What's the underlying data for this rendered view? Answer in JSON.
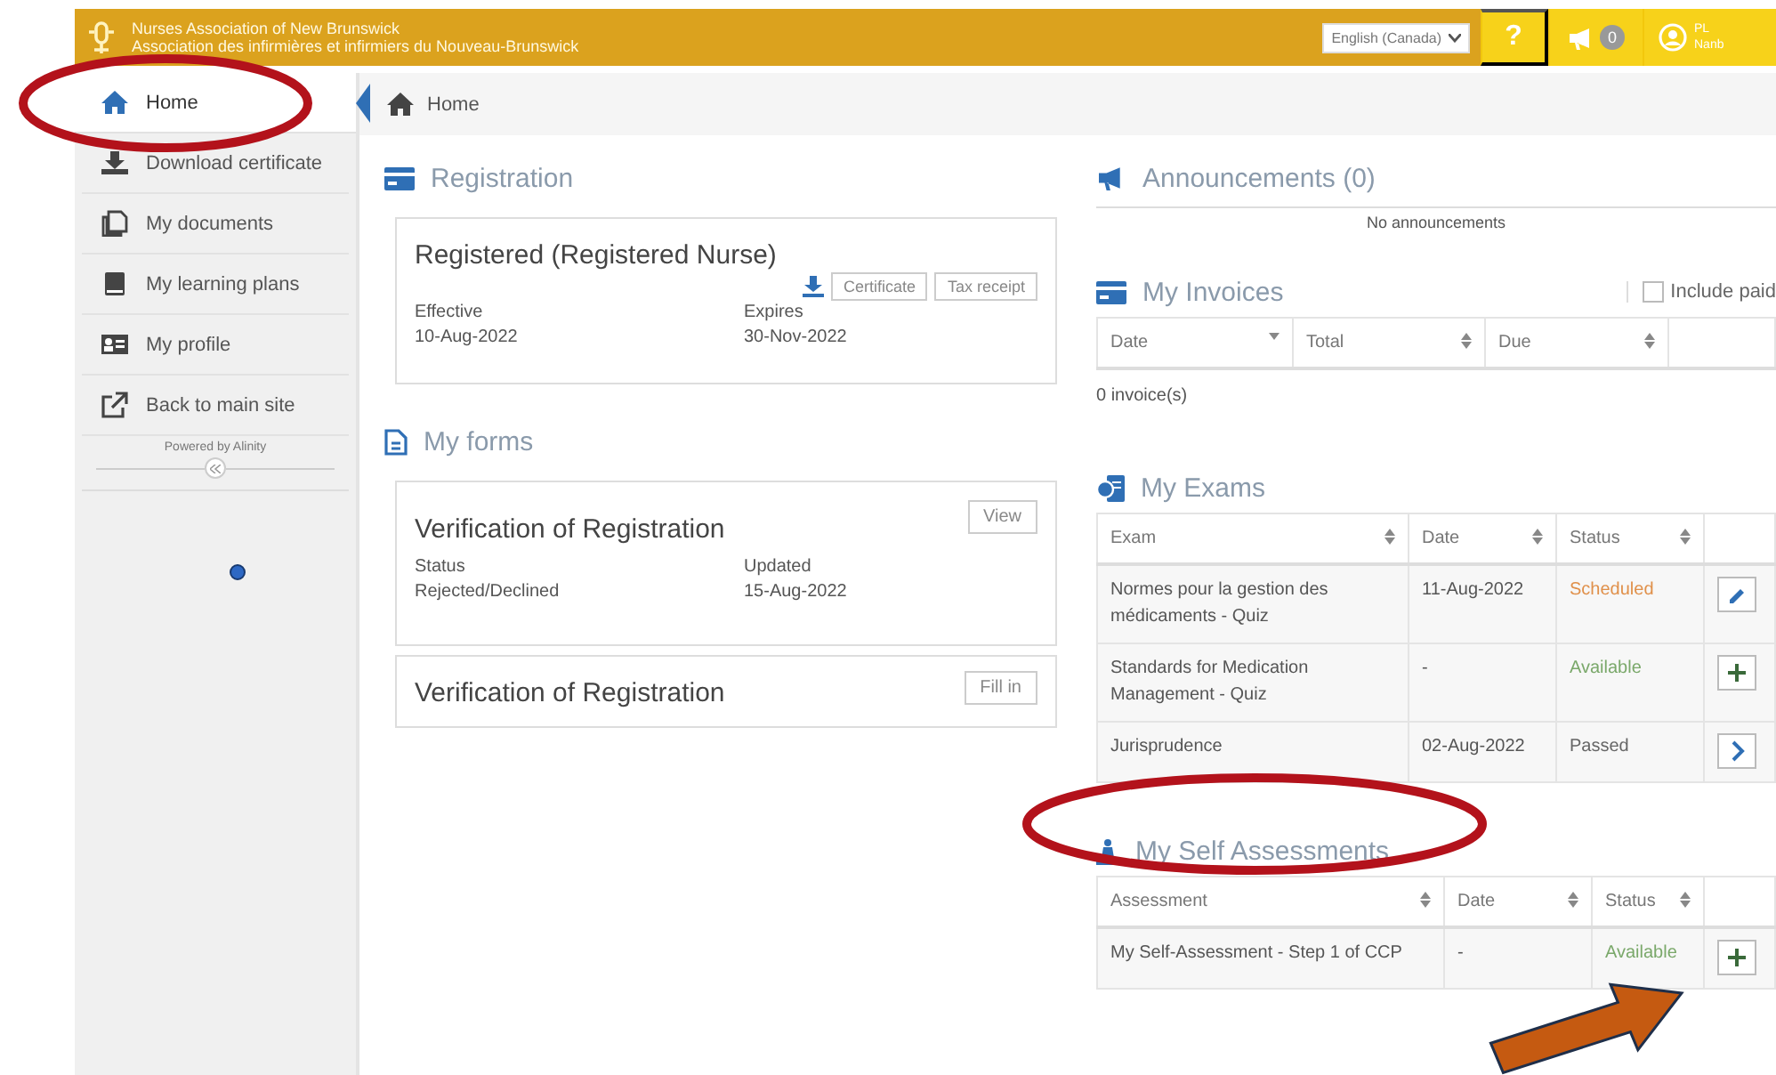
{
  "header": {
    "title": "Nurses Association of New Brunswick",
    "subtitle": "Association des infirmières et infirmiers du Nouveau-Brunswick",
    "language": "English (Canada)",
    "help": "?",
    "notification_count": "0",
    "user_initials": "PL",
    "user_name": "Nanb"
  },
  "sidebar": {
    "items": [
      {
        "label": "Home",
        "selected": true
      },
      {
        "label": "Download certificate",
        "selected": false
      },
      {
        "label": "My documents",
        "selected": false
      },
      {
        "label": "My learning plans",
        "selected": false
      },
      {
        "label": "My profile",
        "selected": false
      },
      {
        "label": "Back to main site",
        "selected": false
      }
    ],
    "powered_by": "Powered by Alinity"
  },
  "breadcrumb": "Home",
  "registration": {
    "title": "Registration",
    "status": "Registered (Registered Nurse)",
    "buttons": [
      "Certificate",
      "Tax receipt"
    ],
    "fields": [
      {
        "label": "Effective",
        "value": "10-Aug-2022"
      },
      {
        "label": "Expires",
        "value": "30-Nov-2022"
      }
    ]
  },
  "forms": {
    "title": "My forms",
    "items": [
      {
        "title": "Verification of Registration",
        "button": "View",
        "fields": [
          {
            "label": "Status",
            "value": "Rejected/Declined"
          },
          {
            "label": "Updated",
            "value": "15-Aug-2022"
          }
        ]
      },
      {
        "title": "Verification of Registration",
        "button": "Fill in"
      }
    ]
  },
  "announcements": {
    "title": "Announcements (0)",
    "empty": "No announcements"
  },
  "invoices": {
    "title": "My Invoices",
    "include_paid": {
      "label": "Include paid",
      "checked": false
    },
    "columns": [
      "Date",
      "Total",
      "Due"
    ],
    "count": "0 invoice(s)"
  },
  "exams": {
    "title": "My Exams",
    "columns": [
      "Exam",
      "Date",
      "Status"
    ],
    "rows": [
      {
        "name": "Normes pour la gestion des médicaments - Quiz",
        "date": "11-Aug-2022",
        "status": "Scheduled",
        "color": "#e0904a",
        "kind": "edit"
      },
      {
        "name": "Standards for Medication Management - Quiz",
        "date": "-",
        "status": "Available",
        "color": "#7aa86a",
        "kind": "add"
      },
      {
        "name": "Jurisprudence",
        "date": "02-Aug-2022",
        "status": "Passed",
        "color": "#666666",
        "kind": "open"
      }
    ]
  },
  "self_assessments": {
    "title": "My Self Assessments",
    "columns": [
      "Assessment",
      "Date",
      "Status"
    ],
    "rows": [
      {
        "name": "My Self-Assessment - Step 1 of CCP",
        "date": "-",
        "status": "Available",
        "color": "#7aa86a",
        "kind": "add"
      }
    ]
  },
  "annotations": [
    {
      "kind": "ellipse"
    },
    {
      "kind": "ellipse"
    },
    {
      "kind": "arrow"
    }
  ]
}
